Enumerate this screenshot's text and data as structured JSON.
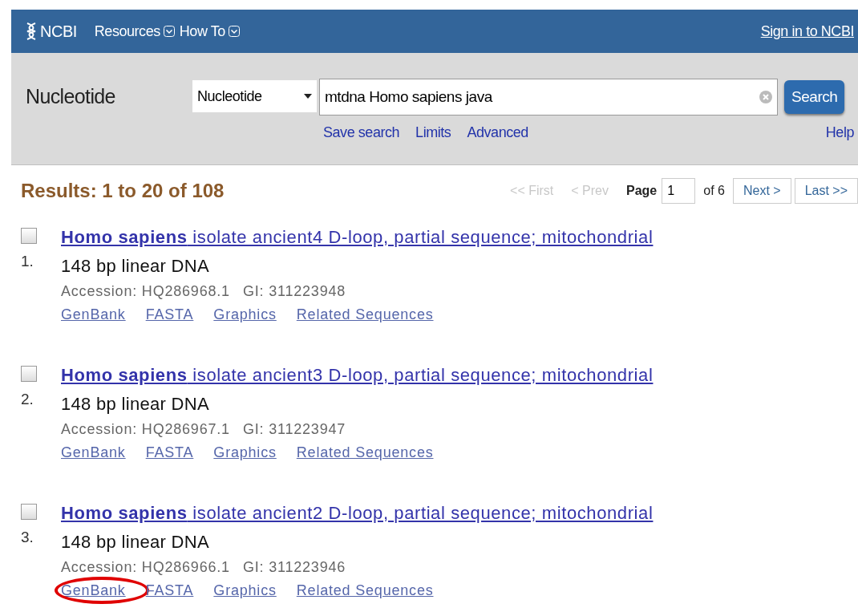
{
  "header": {
    "logo": "NCBI",
    "menus": [
      {
        "label": "Resources"
      },
      {
        "label": "How To"
      }
    ],
    "sign_in": "Sign in to NCBI"
  },
  "search": {
    "title": "Nucleotide",
    "database": "Nucleotide",
    "query": "mtdna Homo sapiens java",
    "button": "Search",
    "links": [
      "Save search",
      "Limits",
      "Advanced"
    ],
    "help": "Help"
  },
  "results": {
    "summary": "Results: 1 to 20 of 108",
    "pager": {
      "first": "<< First",
      "prev": "< Prev",
      "page_label": "Page",
      "page": "1",
      "of": "of 6",
      "next": "Next >",
      "last": "Last >>"
    },
    "items": [
      {
        "number": "1.",
        "checked": false,
        "title": "**Homo sapiens** isolate ancient4 D-loop, partial sequence; mitochondrial",
        "description": "148 bp linear DNA",
        "accession": "Accession: HQ286968.1",
        "gi": "GI: 311223948",
        "links": [
          {
            "label": "GenBank",
            "circled": false
          },
          {
            "label": "FASTA",
            "circled": false
          },
          {
            "label": "Graphics",
            "circled": false
          },
          {
            "label": "Related Sequences",
            "circled": false
          }
        ]
      },
      {
        "number": "2.",
        "checked": false,
        "title": "**Homo sapiens** isolate ancient3 D-loop, partial sequence; mitochondrial",
        "description": "148 bp linear DNA",
        "accession": "Accession: HQ286967.1",
        "gi": "GI: 311223947",
        "links": [
          {
            "label": "GenBank",
            "circled": false
          },
          {
            "label": "FASTA",
            "circled": false
          },
          {
            "label": "Graphics",
            "circled": false
          },
          {
            "label": "Related Sequences",
            "circled": false
          }
        ]
      },
      {
        "number": "3.",
        "checked": false,
        "title": "**Homo sapiens** isolate ancient2 D-loop, partial sequence; mitochondrial",
        "description": "148 bp linear DNA",
        "accession": "Accession: HQ286966.1",
        "gi": "GI: 311223946",
        "links": [
          {
            "label": "GenBank",
            "circled": true
          },
          {
            "label": "FASTA",
            "circled": false
          },
          {
            "label": "Graphics",
            "circled": false
          },
          {
            "label": "Related Sequences",
            "circled": false
          }
        ]
      }
    ]
  }
}
